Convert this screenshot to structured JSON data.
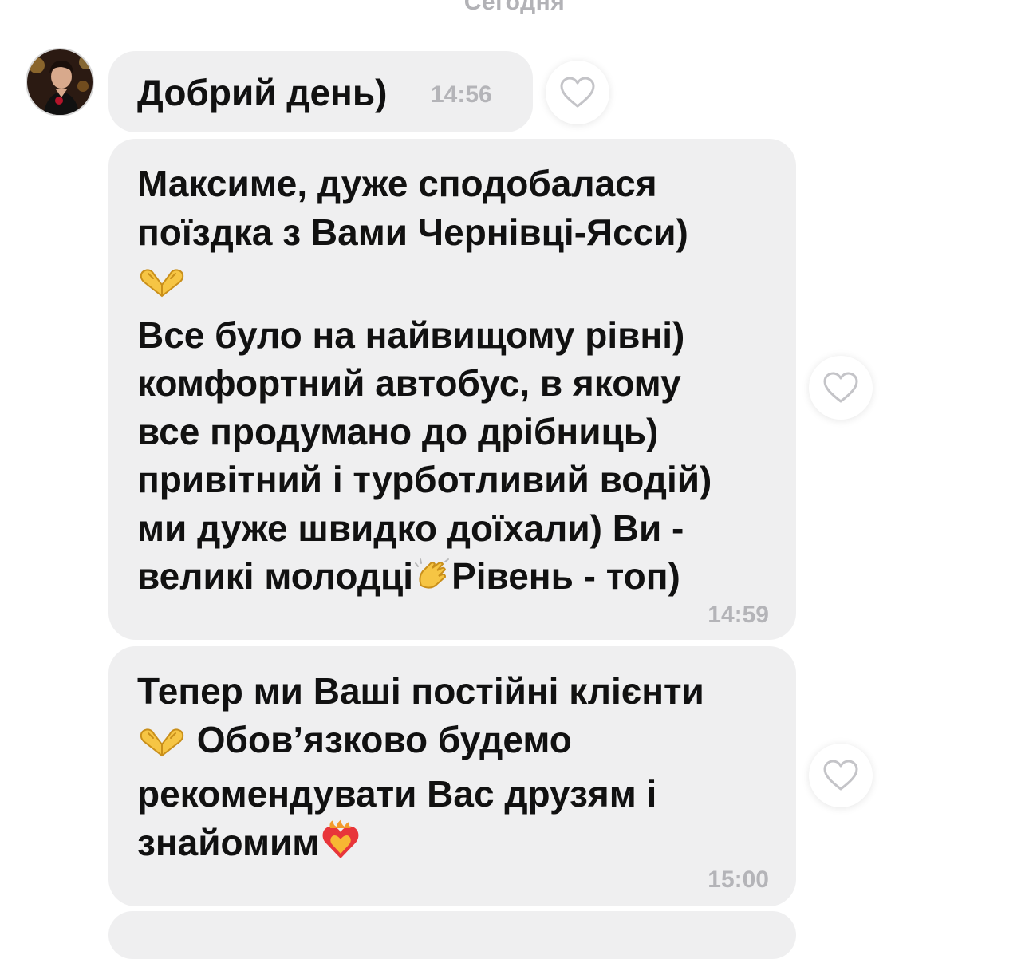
{
  "chat": {
    "date_separator": "Сегодня",
    "messages": [
      {
        "id": "m1",
        "text": "Добрий день)",
        "time": "14:56",
        "like_icon": "heart-outline-icon"
      },
      {
        "id": "m2",
        "lines": [
          "Максиме, дуже сподобалася",
          "поїздка з Вами Чернівці-Ясси)",
          "Все було на найвищому рівні)",
          "комфортний автобус, в якому",
          "все продумано до дрібниць)",
          "привітний і турботливий водій)",
          "ми дуже швидко доїхали) Ви -",
          "великі молодці",
          "Рівень - топ)"
        ],
        "emojis": [
          "heart-hands-emoji",
          "clapping-hands-emoji"
        ],
        "time": "14:59",
        "like_icon": "heart-outline-icon"
      },
      {
        "id": "m3",
        "lines": [
          "Тепер ми Ваші постійні клієнти",
          " Обов’язково будемо",
          "рекомендувати Вас друзям і",
          "знайомим"
        ],
        "emojis": [
          "heart-hands-emoji",
          "heart-on-fire-emoji"
        ],
        "time": "15:00",
        "like_icon": "heart-outline-icon"
      }
    ]
  },
  "colors": {
    "bubble_bg": "#efeff0",
    "timestamp": "#b4b4b8",
    "date_separator": "#b2b2b6",
    "text": "#111111",
    "heart_outline": "#c4c4c8"
  }
}
